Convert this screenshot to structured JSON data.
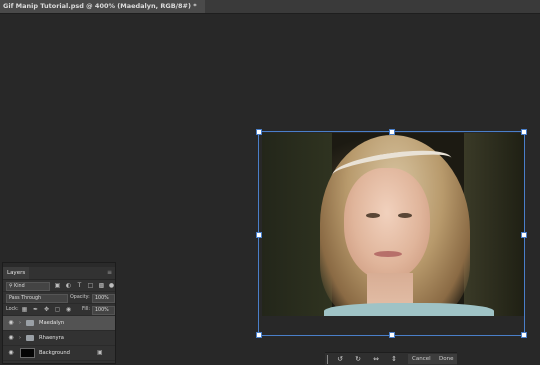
{
  "document": {
    "tab_title": "Gif Manip Tutorial.psd @ 400% (Maedalyn, RGB/8#) *"
  },
  "colors": {
    "app_background": "#282828",
    "panel": "#323232",
    "transform_accent": "#4a7fc9",
    "selected_row": "#535353"
  },
  "layers_panel": {
    "title": "Layers",
    "filter_kind": "Kind",
    "blend_mode": "Pass Through",
    "opacity_label": "Opacity:",
    "opacity_value": "100%",
    "lock_label": "Lock:",
    "fill_label": "Fill:",
    "fill_value": "100%",
    "layers": [
      {
        "name": "Maedalyn",
        "type": "group",
        "visible": true,
        "selected": true
      },
      {
        "name": "Rhaenyra",
        "type": "group",
        "visible": true,
        "selected": false
      },
      {
        "name": "Background",
        "type": "background",
        "visible": true,
        "locked": true
      }
    ]
  },
  "transform_bar": {
    "icons": [
      "rotate-left-icon",
      "rotate-right-icon",
      "flip-horizontal-icon",
      "flip-vertical-icon"
    ],
    "cancel_label": "Cancel",
    "done_label": "Done"
  }
}
